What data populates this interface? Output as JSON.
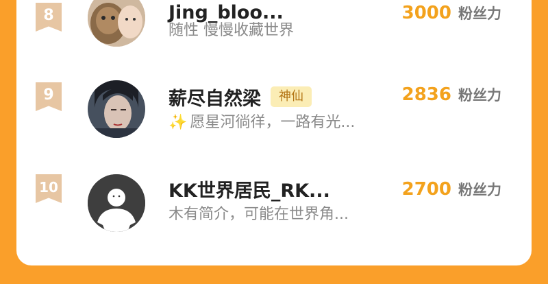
{
  "theme": {
    "accent": "#f3a21d",
    "background": "#fa9f2a",
    "rank_badge": "#e7c6a3",
    "tag_bg": "#fbedb5"
  },
  "fans_unit": "粉丝力",
  "rows": [
    {
      "rank": "8",
      "name": "Jing_bloo...",
      "badge": "",
      "bio_icon": "",
      "bio": "随性 慢慢收藏世界",
      "fans": "3000",
      "avatar": "cat-and-person-photo"
    },
    {
      "rank": "9",
      "name": "薪尽自然梁",
      "badge": "神仙",
      "bio_icon": "sparkles-icon",
      "bio": "愿星河徜徉，一路有光...",
      "fans": "2836",
      "avatar": "character-portrait-photo"
    },
    {
      "rank": "10",
      "name": "KK世界居民_RK...",
      "badge": "",
      "bio_icon": "",
      "bio": "木有简介，可能在世界角...",
      "fans": "2700",
      "avatar": "default-user-avatar"
    }
  ]
}
